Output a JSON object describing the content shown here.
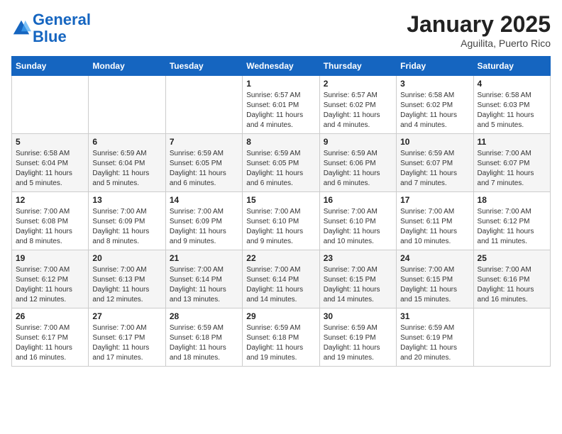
{
  "header": {
    "logo_line1": "General",
    "logo_line2": "Blue",
    "month": "January 2025",
    "location": "Aguilita, Puerto Rico"
  },
  "days_of_week": [
    "Sunday",
    "Monday",
    "Tuesday",
    "Wednesday",
    "Thursday",
    "Friday",
    "Saturday"
  ],
  "weeks": [
    [
      {
        "day": "",
        "info": ""
      },
      {
        "day": "",
        "info": ""
      },
      {
        "day": "",
        "info": ""
      },
      {
        "day": "1",
        "info": "Sunrise: 6:57 AM\nSunset: 6:01 PM\nDaylight: 11 hours and 4 minutes."
      },
      {
        "day": "2",
        "info": "Sunrise: 6:57 AM\nSunset: 6:02 PM\nDaylight: 11 hours and 4 minutes."
      },
      {
        "day": "3",
        "info": "Sunrise: 6:58 AM\nSunset: 6:02 PM\nDaylight: 11 hours and 4 minutes."
      },
      {
        "day": "4",
        "info": "Sunrise: 6:58 AM\nSunset: 6:03 PM\nDaylight: 11 hours and 5 minutes."
      }
    ],
    [
      {
        "day": "5",
        "info": "Sunrise: 6:58 AM\nSunset: 6:04 PM\nDaylight: 11 hours and 5 minutes."
      },
      {
        "day": "6",
        "info": "Sunrise: 6:59 AM\nSunset: 6:04 PM\nDaylight: 11 hours and 5 minutes."
      },
      {
        "day": "7",
        "info": "Sunrise: 6:59 AM\nSunset: 6:05 PM\nDaylight: 11 hours and 6 minutes."
      },
      {
        "day": "8",
        "info": "Sunrise: 6:59 AM\nSunset: 6:05 PM\nDaylight: 11 hours and 6 minutes."
      },
      {
        "day": "9",
        "info": "Sunrise: 6:59 AM\nSunset: 6:06 PM\nDaylight: 11 hours and 6 minutes."
      },
      {
        "day": "10",
        "info": "Sunrise: 6:59 AM\nSunset: 6:07 PM\nDaylight: 11 hours and 7 minutes."
      },
      {
        "day": "11",
        "info": "Sunrise: 7:00 AM\nSunset: 6:07 PM\nDaylight: 11 hours and 7 minutes."
      }
    ],
    [
      {
        "day": "12",
        "info": "Sunrise: 7:00 AM\nSunset: 6:08 PM\nDaylight: 11 hours and 8 minutes."
      },
      {
        "day": "13",
        "info": "Sunrise: 7:00 AM\nSunset: 6:09 PM\nDaylight: 11 hours and 8 minutes."
      },
      {
        "day": "14",
        "info": "Sunrise: 7:00 AM\nSunset: 6:09 PM\nDaylight: 11 hours and 9 minutes."
      },
      {
        "day": "15",
        "info": "Sunrise: 7:00 AM\nSunset: 6:10 PM\nDaylight: 11 hours and 9 minutes."
      },
      {
        "day": "16",
        "info": "Sunrise: 7:00 AM\nSunset: 6:10 PM\nDaylight: 11 hours and 10 minutes."
      },
      {
        "day": "17",
        "info": "Sunrise: 7:00 AM\nSunset: 6:11 PM\nDaylight: 11 hours and 10 minutes."
      },
      {
        "day": "18",
        "info": "Sunrise: 7:00 AM\nSunset: 6:12 PM\nDaylight: 11 hours and 11 minutes."
      }
    ],
    [
      {
        "day": "19",
        "info": "Sunrise: 7:00 AM\nSunset: 6:12 PM\nDaylight: 11 hours and 12 minutes."
      },
      {
        "day": "20",
        "info": "Sunrise: 7:00 AM\nSunset: 6:13 PM\nDaylight: 11 hours and 12 minutes."
      },
      {
        "day": "21",
        "info": "Sunrise: 7:00 AM\nSunset: 6:14 PM\nDaylight: 11 hours and 13 minutes."
      },
      {
        "day": "22",
        "info": "Sunrise: 7:00 AM\nSunset: 6:14 PM\nDaylight: 11 hours and 14 minutes."
      },
      {
        "day": "23",
        "info": "Sunrise: 7:00 AM\nSunset: 6:15 PM\nDaylight: 11 hours and 14 minutes."
      },
      {
        "day": "24",
        "info": "Sunrise: 7:00 AM\nSunset: 6:15 PM\nDaylight: 11 hours and 15 minutes."
      },
      {
        "day": "25",
        "info": "Sunrise: 7:00 AM\nSunset: 6:16 PM\nDaylight: 11 hours and 16 minutes."
      }
    ],
    [
      {
        "day": "26",
        "info": "Sunrise: 7:00 AM\nSunset: 6:17 PM\nDaylight: 11 hours and 16 minutes."
      },
      {
        "day": "27",
        "info": "Sunrise: 7:00 AM\nSunset: 6:17 PM\nDaylight: 11 hours and 17 minutes."
      },
      {
        "day": "28",
        "info": "Sunrise: 6:59 AM\nSunset: 6:18 PM\nDaylight: 11 hours and 18 minutes."
      },
      {
        "day": "29",
        "info": "Sunrise: 6:59 AM\nSunset: 6:18 PM\nDaylight: 11 hours and 19 minutes."
      },
      {
        "day": "30",
        "info": "Sunrise: 6:59 AM\nSunset: 6:19 PM\nDaylight: 11 hours and 19 minutes."
      },
      {
        "day": "31",
        "info": "Sunrise: 6:59 AM\nSunset: 6:19 PM\nDaylight: 11 hours and 20 minutes."
      },
      {
        "day": "",
        "info": ""
      }
    ]
  ]
}
